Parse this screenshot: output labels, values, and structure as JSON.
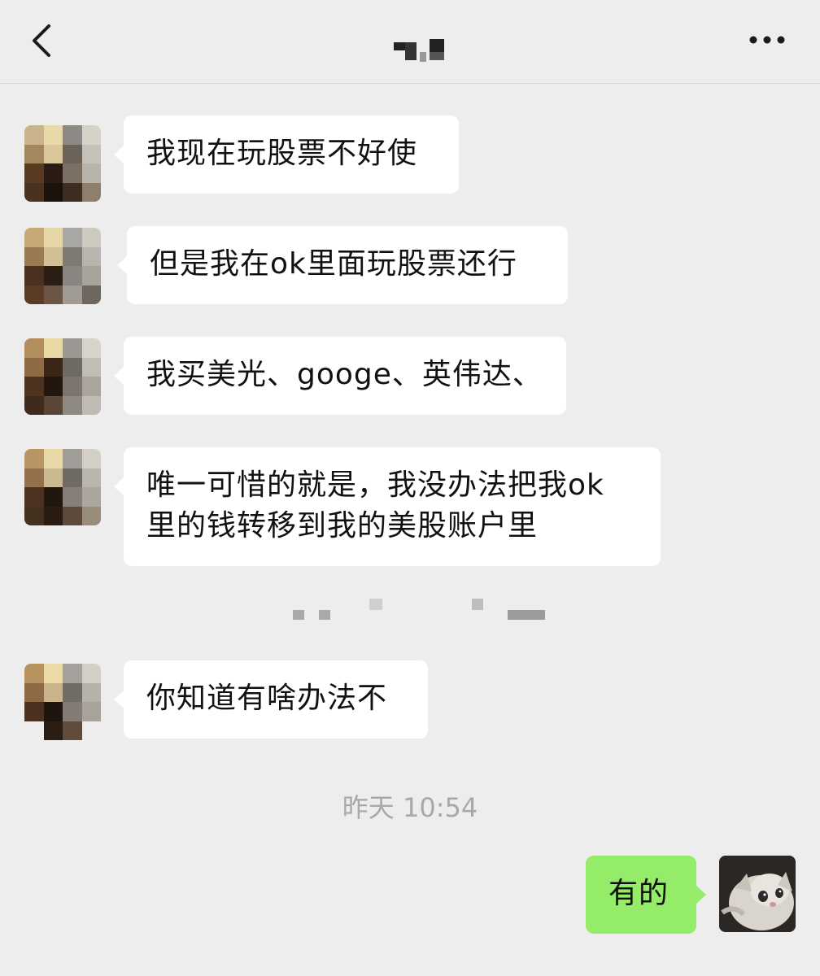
{
  "header": {
    "back_icon": "chevron-left-icon",
    "more_icon": "ellipsis-icon"
  },
  "messages": [
    {
      "sender": "other",
      "text": "我现在玩股票不好使"
    },
    {
      "sender": "other",
      "text": "但是我在ok里面玩股票还行"
    },
    {
      "sender": "other",
      "text": "我买美光、googe、英伟达、"
    },
    {
      "sender": "other",
      "text_line1": "唯一可惜的就是，我没办法把我ok",
      "text_line2": "里的钱转移到我的美股账户里"
    },
    {
      "sender": "other",
      "text": "你知道有啥办法不"
    },
    {
      "sender": "me",
      "text": "有的"
    }
  ],
  "timestamp": "昨天 10:54",
  "colors": {
    "background": "#ededed",
    "incoming_bubble": "#ffffff",
    "outgoing_bubble": "#95ec69",
    "timestamp_text": "#a8a8a8"
  }
}
